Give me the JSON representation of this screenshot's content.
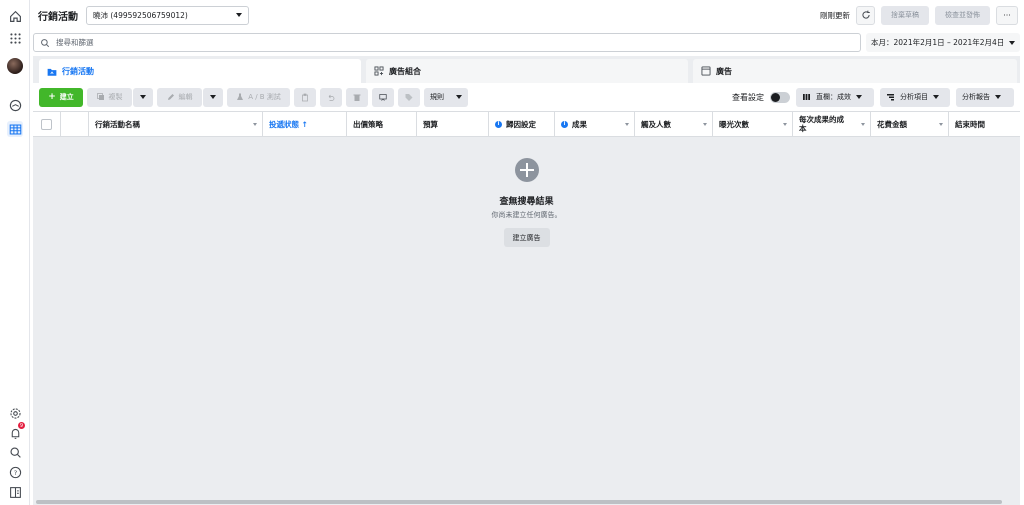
{
  "header": {
    "title": "行銷活動",
    "account": "曉沛 (499592506759012)",
    "updated_label": "剛剛更新",
    "discard_label": "捨棄草稿",
    "review_publish_label": "檢查並發佈",
    "more_label": "···"
  },
  "search": {
    "placeholder": "搜尋和篩選"
  },
  "date_range": {
    "label": "本月：2021年2月1日 – 2021年2月4日"
  },
  "tabs": [
    {
      "label": "行銷活動",
      "icon": "folder-icon",
      "active": true
    },
    {
      "label": "廣告組合",
      "icon": "grid-icon",
      "active": false
    },
    {
      "label": "廣告",
      "icon": "ad-icon",
      "active": false
    }
  ],
  "toolbar": {
    "create_label": "建立",
    "duplicate_label": "複製",
    "edit_label": "編輯",
    "ab_test_label": "A / B 測試",
    "rules_label": "規則",
    "view_settings_label": "查看設定",
    "columns_label": "直欄：成效",
    "breakdown_label": "分析項目",
    "reports_label": "分析報告"
  },
  "table": {
    "columns": [
      "行銷活動名稱",
      "投遞狀態 ↑",
      "出價策略",
      "預算",
      "歸因設定",
      "成果",
      "觸及人數",
      "曝光次數",
      "每次成果的成本",
      "花費金額",
      "結束時間"
    ]
  },
  "empty_state": {
    "title": "查無搜尋結果",
    "subtitle": "你尚未建立任何廣告。",
    "button": "建立廣告"
  },
  "colors": {
    "accent": "#1877f2",
    "create_green": "#42b72a",
    "body_gray": "#ebedf0",
    "notification_red": "#e41e3f"
  },
  "notifications": {
    "count": "9"
  }
}
